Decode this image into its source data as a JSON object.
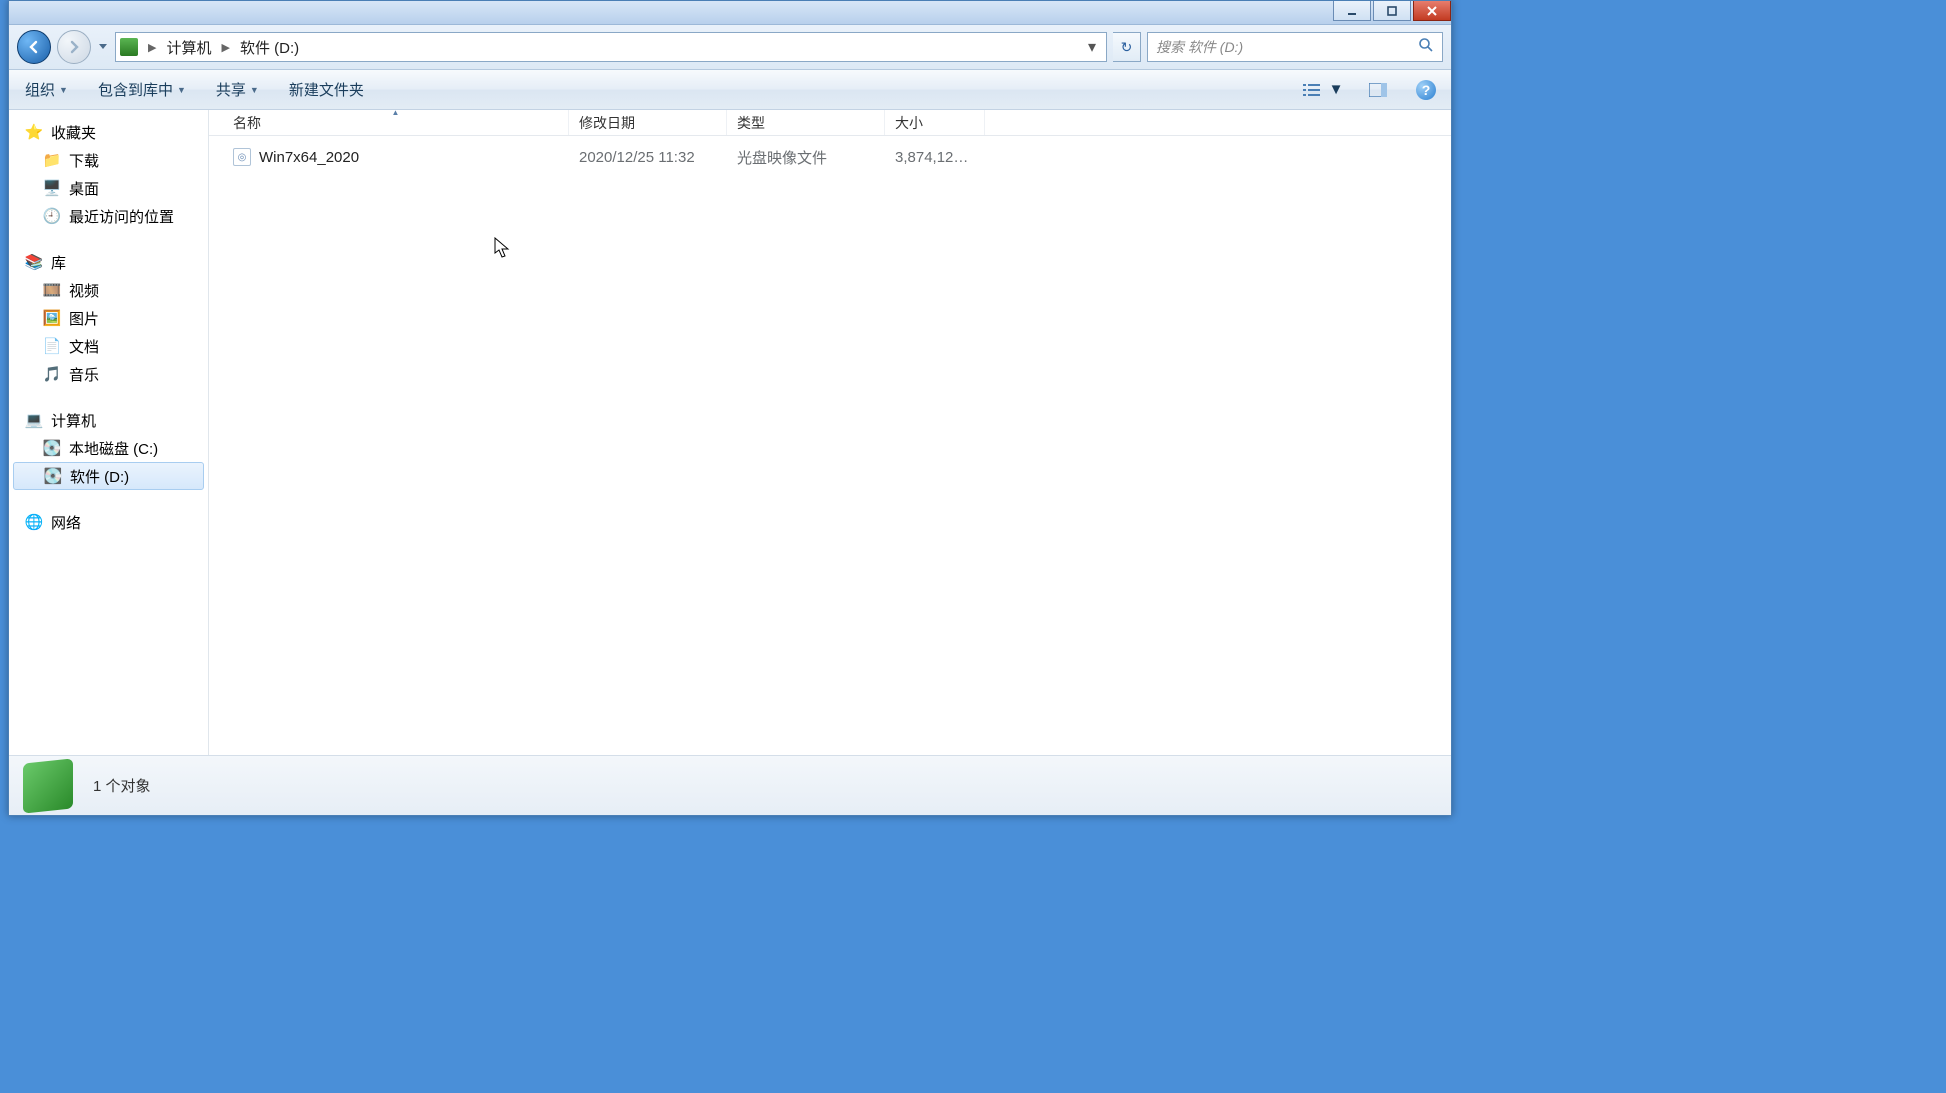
{
  "window": {
    "breadcrumbs": [
      "计算机",
      "软件 (D:)"
    ]
  },
  "search": {
    "placeholder": "搜索 软件 (D:)"
  },
  "toolbar": {
    "organize": "组织",
    "include": "包含到库中",
    "share": "共享",
    "new_folder": "新建文件夹"
  },
  "columns": {
    "name": "名称",
    "date": "修改日期",
    "type": "类型",
    "size": "大小"
  },
  "sidebar": {
    "favorites": "收藏夹",
    "downloads": "下载",
    "desktop": "桌面",
    "recent": "最近访问的位置",
    "libraries": "库",
    "videos": "视频",
    "pictures": "图片",
    "documents": "文档",
    "music": "音乐",
    "computer": "计算机",
    "local_c": "本地磁盘 (C:)",
    "drive_d": "软件 (D:)",
    "network": "网络"
  },
  "files": [
    {
      "name": "Win7x64_2020",
      "date": "2020/12/25 11:32",
      "type": "光盘映像文件",
      "size": "3,874,126 ..."
    }
  ],
  "status": {
    "text": "1 个对象"
  }
}
